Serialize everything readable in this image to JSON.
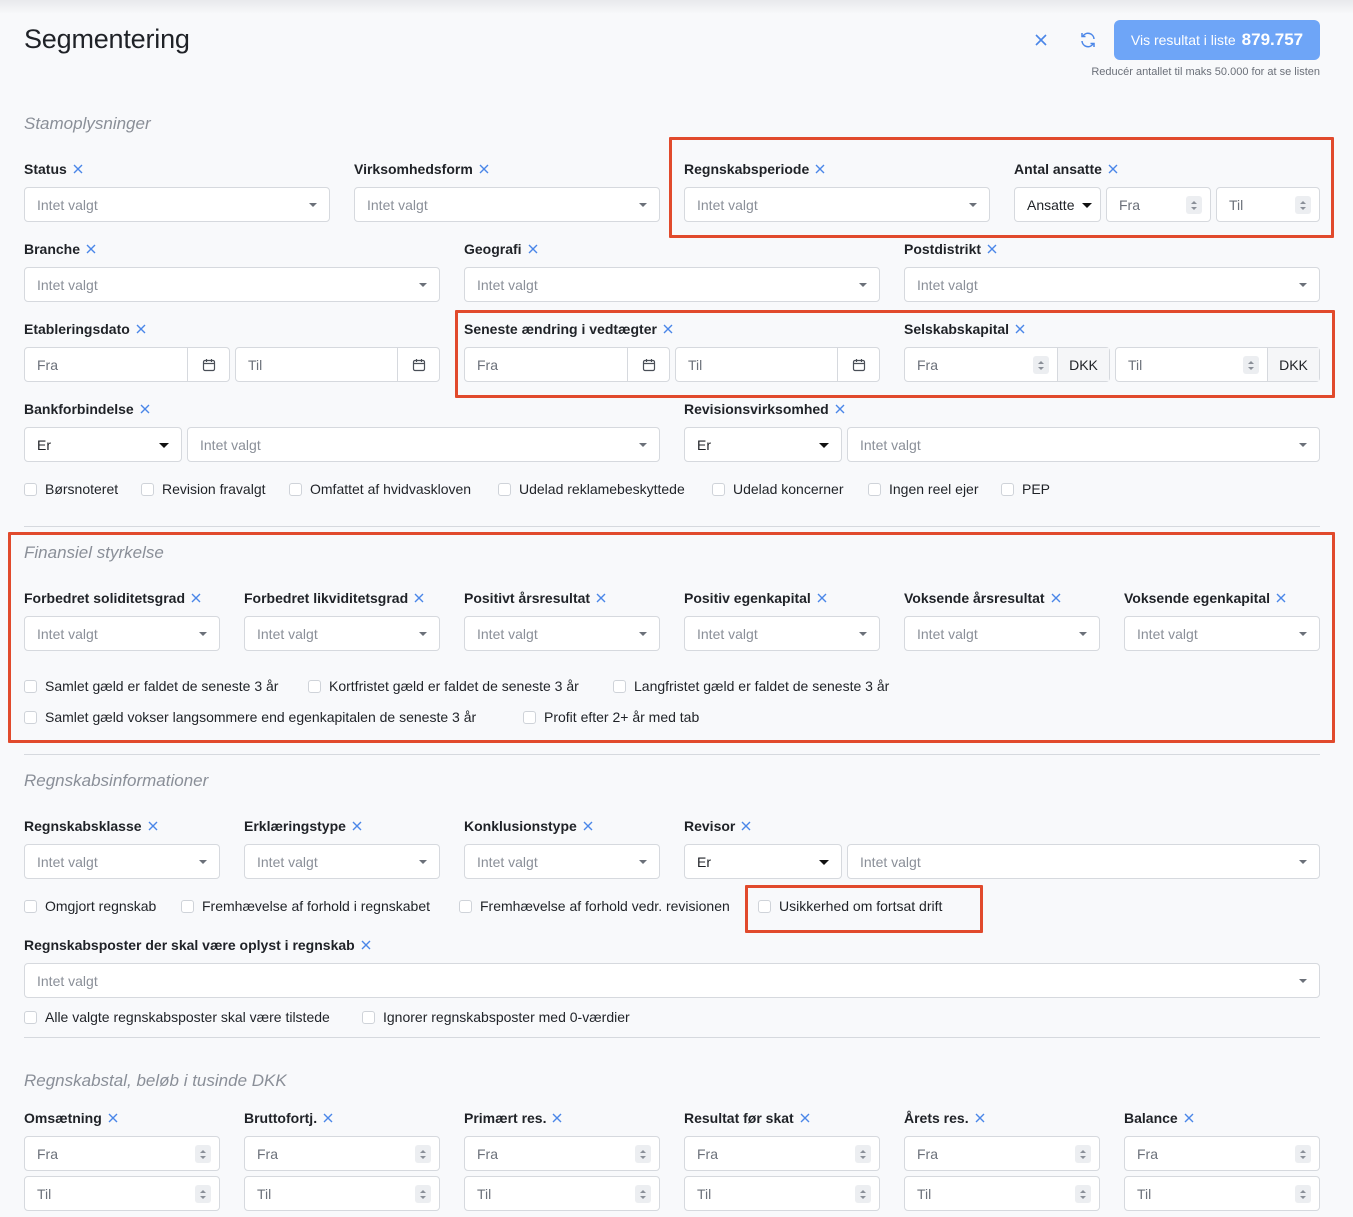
{
  "header": {
    "title": "Segmentering",
    "button_label": "Vis resultat i liste",
    "button_count": "879.757",
    "hint": "Reducér antallet til maks 50.000 for at se listen"
  },
  "common": {
    "placeholder": "Intet valgt",
    "fra": "Fra",
    "til": "Til",
    "er": "Er",
    "dkk": "DKK",
    "ansatte": "Ansatte"
  },
  "stam": {
    "title": "Stamoplysninger",
    "status": "Status",
    "virksomhedsform": "Virksomhedsform",
    "regnskabsperiode": "Regnskabsperiode",
    "antal_ansatte": "Antal ansatte",
    "branche": "Branche",
    "geografi": "Geografi",
    "postdistrikt": "Postdistrikt",
    "etableringsdato": "Etableringsdato",
    "seneste": "Seneste ændring i vedtægter",
    "selskabskapital": "Selskabskapital",
    "bankforbindelse": "Bankforbindelse",
    "revisionsvirksomhed": "Revisionsvirksomhed",
    "checks": [
      "Børsnoteret",
      "Revision fravalgt",
      "Omfattet af hvidvaskloven",
      "Udelad reklamebeskyttede",
      "Udelad koncerner",
      "Ingen reel ejer",
      "PEP"
    ]
  },
  "fin": {
    "title": "Finansiel styrkelse",
    "labels": [
      "Forbedret soliditetsgrad",
      "Forbedret likviditetsgrad",
      "Positivt årsresultat",
      "Positiv egenkapital",
      "Voksende årsresultat",
      "Voksende egenkapital"
    ],
    "checks": [
      "Samlet gæld er faldet de seneste 3 år",
      "Kortfristet gæld er faldet de seneste 3 år",
      "Langfristet gæld er faldet de seneste 3 år",
      "Samlet gæld vokser langsommere end egenkapitalen de seneste 3 år",
      "Profit efter 2+ år med tab"
    ]
  },
  "regn": {
    "title": "Regnskabsinformationer",
    "labels": [
      "Regnskabsklasse",
      "Erklæringstype",
      "Konklusionstype",
      "Revisor"
    ],
    "checks": [
      "Omgjort regnskab",
      "Fremhævelse af forhold i regnskabet",
      "Fremhævelse af forhold vedr. revisionen",
      "Usikkerhed om fortsat drift"
    ],
    "poster_label": "Regnskabsposter der skal være oplyst i regnskab",
    "poster_checks": [
      "Alle valgte regnskabsposter skal være tilstede",
      "Ignorer regnskabsposter med 0-værdier"
    ]
  },
  "tal": {
    "title": "Regnskabstal, beløb i tusinde DKK",
    "labels": [
      "Omsætning",
      "Bruttofortj.",
      "Primært res.",
      "Resultat før skat",
      "Årets res.",
      "Balance"
    ]
  },
  "colors": {
    "accent": "#6ea5f7",
    "highlight": "#e14a2c",
    "clear_icon": "#4a86e8"
  }
}
